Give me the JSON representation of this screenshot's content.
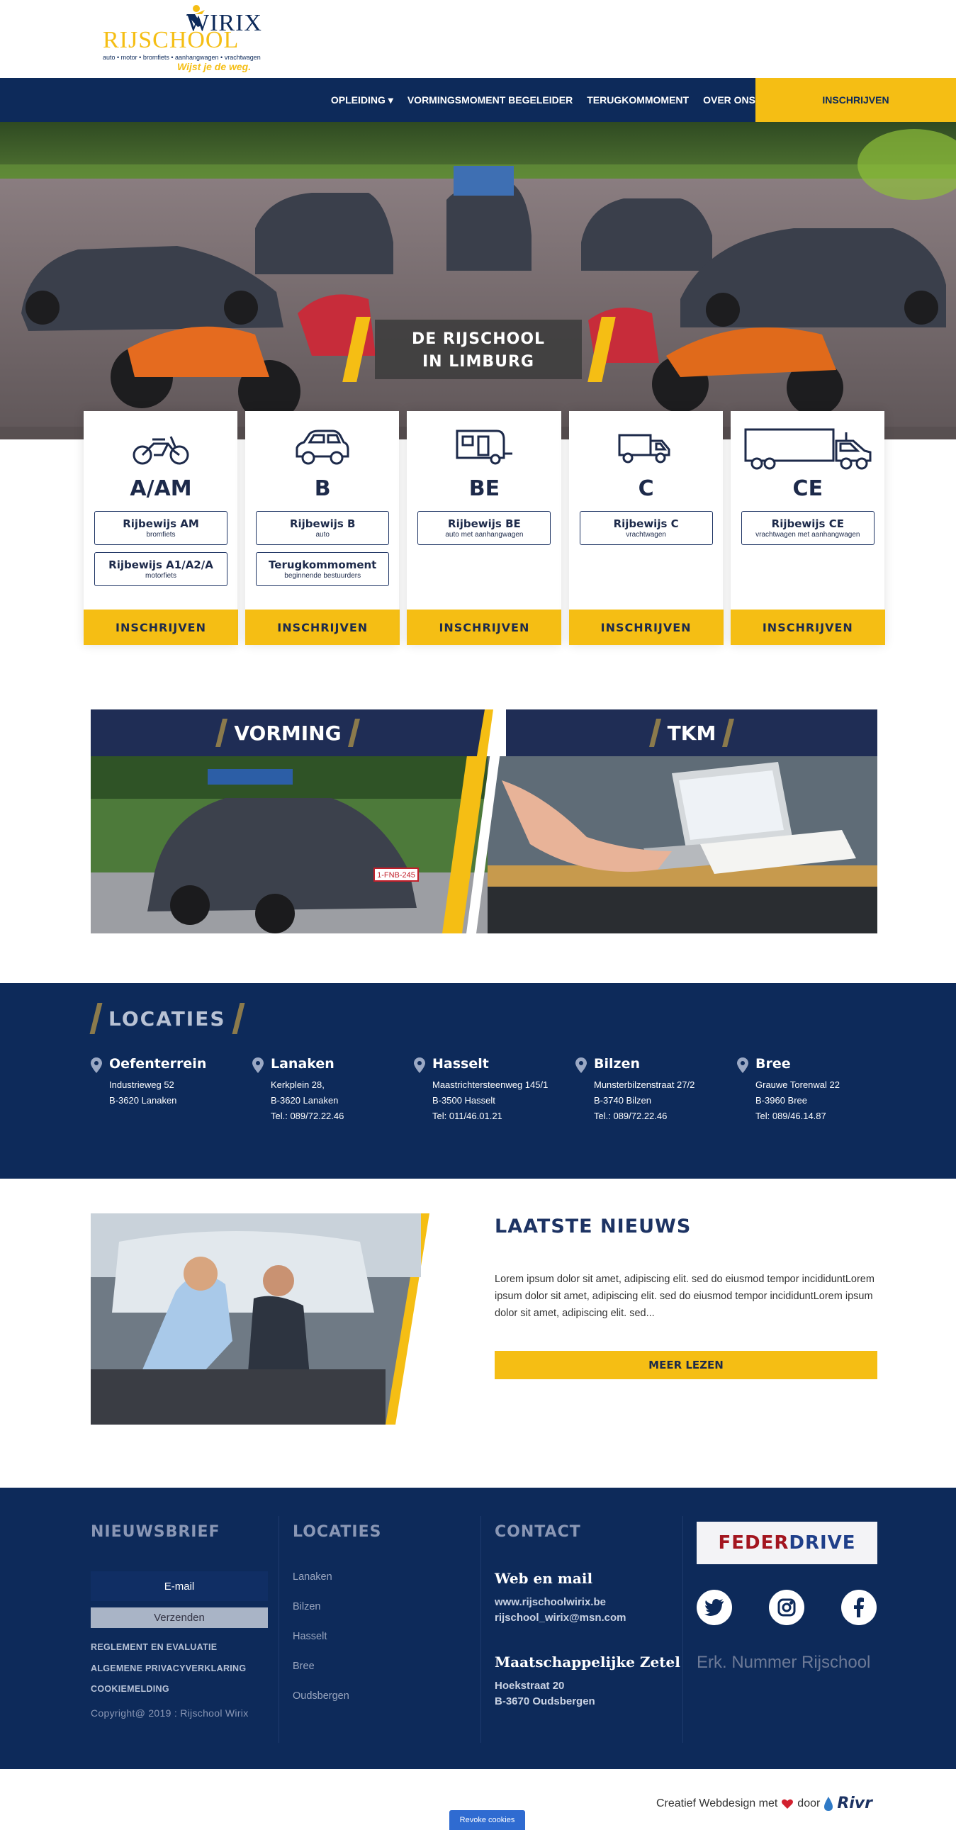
{
  "header": {
    "logo_word1": "RIJSCHOOL",
    "logo_word2": "WIRIX",
    "logo_tagline": "auto • motor • bromfiets • aanhangwagen • vrachtwagen",
    "logo_slogan": "Wijst je de weg."
  },
  "nav": {
    "items": [
      {
        "label": "OPLEIDING ▾"
      },
      {
        "label": "VORMINGSMOMENT BEGELEIDER"
      },
      {
        "label": "TERUGKOMMOMENT"
      },
      {
        "label": "OVER ONS"
      }
    ],
    "cta": "INSCHRIJVEN"
  },
  "hero": {
    "line1": "DE RIJSCHOOL",
    "line2": "IN LIMBURG"
  },
  "cards": [
    {
      "code": "A/AM",
      "icon": "motorcycle-icon",
      "pills": [
        {
          "title": "Rijbewijs AM",
          "sub": "bromfiets"
        },
        {
          "title": "Rijbewijs A1/A2/A",
          "sub": "motorfiets"
        }
      ],
      "button": "INSCHRIJVEN"
    },
    {
      "code": "B",
      "icon": "car-icon",
      "pills": [
        {
          "title": "Rijbewijs B",
          "sub": "auto"
        },
        {
          "title": "Terugkommoment",
          "sub": "beginnende bestuurders"
        }
      ],
      "button": "INSCHRIJVEN"
    },
    {
      "code": "BE",
      "icon": "caravan-icon",
      "pills": [
        {
          "title": "Rijbewijs BE",
          "sub": "auto met aanhangwagen"
        }
      ],
      "button": "INSCHRIJVEN"
    },
    {
      "code": "C",
      "icon": "truck-icon",
      "pills": [
        {
          "title": "Rijbewijs C",
          "sub": "vrachtwagen"
        }
      ],
      "button": "INSCHRIJVEN"
    },
    {
      "code": "CE",
      "icon": "semi-truck-icon",
      "pills": [
        {
          "title": "Rijbewijs CE",
          "sub": "vrachtwagen met aanhangwagen"
        }
      ],
      "button": "INSCHRIJVEN"
    }
  ],
  "promo": {
    "left_title": "VORMING",
    "right_title": "TKM",
    "plate": "1-FNB-245"
  },
  "locaties": {
    "title": "LOCATIES",
    "items": [
      {
        "name": "Oefenterrein",
        "lines": [
          "Industrieweg 52",
          "B-3620 Lanaken"
        ]
      },
      {
        "name": "Lanaken",
        "lines": [
          "Kerkplein 28,",
          "B-3620 Lanaken",
          "Tel.: 089/72.22.46"
        ]
      },
      {
        "name": "Hasselt",
        "lines": [
          "Maastrichtersteenweg 145/1",
          "B-3500 Hasselt",
          "Tel: 011/46.01.21"
        ]
      },
      {
        "name": "Bilzen",
        "lines": [
          "Munsterbilzenstraat 27/2",
          "B-3740 Bilzen",
          "Tel.: 089/72.22.46"
        ]
      },
      {
        "name": "Bree",
        "lines": [
          "Grauwe Torenwal 22",
          "B-3960 Bree",
          "Tel: 089/46.14.87"
        ]
      }
    ]
  },
  "news": {
    "title": "LAATSTE NIEUWS",
    "body": "Lorem ipsum dolor sit amet, adipiscing elit. sed do eiusmod tempor incididuntLorem ipsum dolor sit amet, adipiscing elit. sed do eiusmod tempor incididuntLorem ipsum dolor sit amet, adipiscing elit. sed...",
    "button": "MEER LEZEN"
  },
  "footer": {
    "newsletter_title": "NIEUWSBRIEF",
    "email_placeholder": "E-mail",
    "send_label": "Verzenden",
    "links": [
      "REGLEMENT EN EVALUATIE",
      "ALGEMENE PRIVACYVERKLARING",
      "COOKIEMELDING"
    ],
    "copyright": "Copyright@ 2019 : Rijschool Wirix",
    "locaties_title": "LOCATIES",
    "locaties": [
      "Lanaken",
      "Bilzen",
      "Hasselt",
      "Bree",
      "Oudsbergen"
    ],
    "contact_title": "CONTACT",
    "web_title": "Web en mail",
    "web_lines": [
      "www.rijschoolwirix.be",
      "rijschool_wirix@msn.com"
    ],
    "zetel_title": "Maatschappelijke Zetel",
    "zetel_lines": [
      "Hoekstraat 20",
      "B-3670 Oudsbergen"
    ],
    "partner_a": "FEDER",
    "partner_b": "DRIVE",
    "erk": "Erk. Nummer Rijschool"
  },
  "bottom": {
    "credit_pre": "Creatief Webdesign met",
    "credit_post": "door",
    "brand": "Rivr",
    "revoke": "Revoke cookies"
  },
  "colors": {
    "navy": "#0d2a5a",
    "yellow": "#f5be14",
    "dark_card": "#1f2d55"
  }
}
